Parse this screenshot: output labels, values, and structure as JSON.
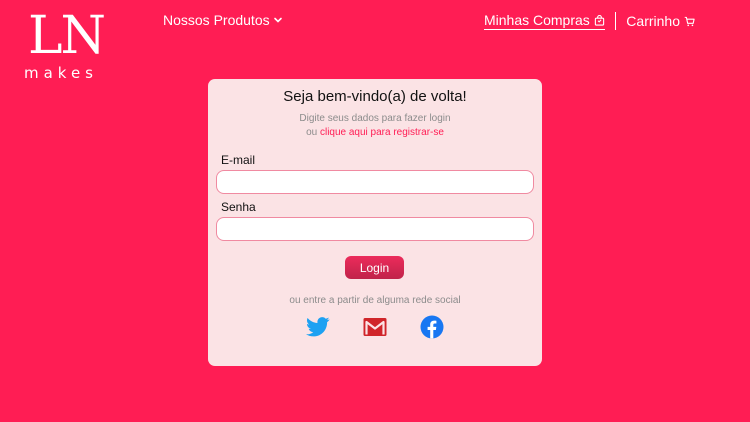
{
  "header": {
    "logo_mark": "LN",
    "logo_sub": "makes",
    "nav_products": "Nossos Produtos",
    "nav_orders": "Minhas Compras",
    "nav_cart": "Carrinho"
  },
  "login": {
    "title": "Seja bem-vindo(a) de volta!",
    "subtitle_line1": "Digite seus dados para fazer login",
    "subtitle_prefix": "ou",
    "register_link": "clique aqui para registrar-se",
    "email_label": "E-mail",
    "email_value": "",
    "password_label": "Senha",
    "password_value": "",
    "login_button": "Login",
    "social_text": "ou entre a partir de alguma rede social"
  },
  "icons": {
    "products_dropdown": "chevron-down-icon",
    "orders": "shopping-bag-icon",
    "cart": "cart-icon",
    "twitter": "twitter-icon",
    "gmail": "gmail-icon",
    "facebook": "facebook-icon"
  },
  "colors": {
    "background": "#ff1d54",
    "card": "#fbe3e5",
    "accent": "#ff1d54",
    "twitter": "#1da1f2",
    "gmail": "#d0252a",
    "facebook": "#1877f2"
  }
}
